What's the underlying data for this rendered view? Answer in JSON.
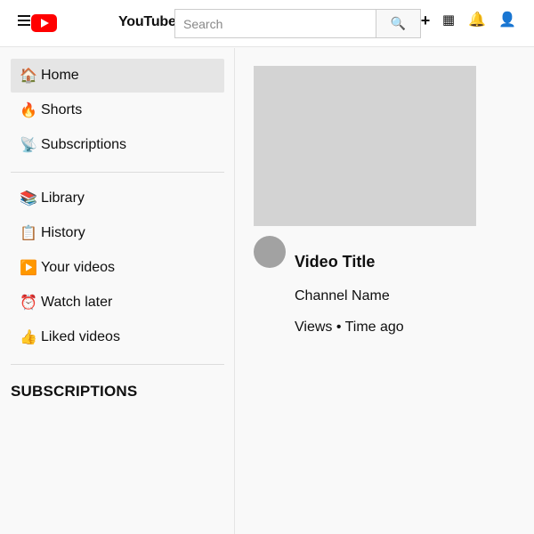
{
  "header": {
    "brand": "YouTube",
    "search_placeholder": "Search",
    "icons": {
      "menu": "hamburger-menu-icon",
      "search": "magnifier-icon",
      "create": "plus-icon",
      "apps": "grid-icon",
      "notifications": "bell-icon",
      "account": "user-icon"
    }
  },
  "sidebar": {
    "primary": [
      {
        "label": "Home",
        "icon": "🏠"
      },
      {
        "label": "Shorts",
        "icon": "🔥"
      },
      {
        "label": "Subscriptions",
        "icon": "📡"
      }
    ],
    "secondary": [
      {
        "label": "Library",
        "icon": "📚"
      },
      {
        "label": "History",
        "icon": "📋"
      },
      {
        "label": "Your videos",
        "icon": "▶️"
      },
      {
        "label": "Watch later",
        "icon": "⏰"
      },
      {
        "label": "Liked videos",
        "icon": "👍"
      }
    ],
    "section_title": "SUBSCRIPTIONS"
  },
  "video": {
    "title": "Video Title",
    "channel": "Channel Name",
    "meta": "Views • Time ago"
  },
  "colors": {
    "brand_red": "#ff0000",
    "active_item_bg": "#e5e5e5",
    "thumbnail_placeholder": "#d3d3d3",
    "avatar_placeholder": "#a2a2a2"
  }
}
